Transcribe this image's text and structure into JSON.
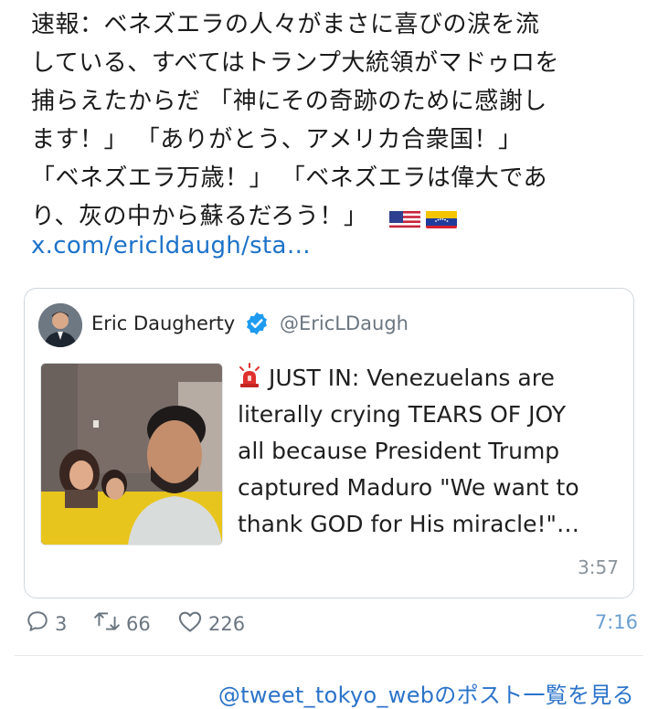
{
  "post": {
    "text_lines": [
      "速報：ベネズエラの人々がまさに喜びの涙を流",
      "している、すべてはトランプ大統領がマドゥロを",
      "捕らえたからだ 「神にその奇跡のために感謝し",
      "ます！」 「ありがとう、アメリカ合衆国！」",
      "「ベネズエラ万歳！」 「ベネズエラは偉大であ",
      "り、灰の中から蘇るだろう！」"
    ],
    "flags": [
      "us-flag-icon",
      "venezuela-flag-icon"
    ],
    "link": "x.com/ericldaugh/sta…",
    "time": "7:16",
    "replies": "3",
    "reposts": "66",
    "likes": "226"
  },
  "quote": {
    "name": "Eric Daugherty",
    "handle": "@EricLDaugh",
    "text_lines": [
      "JUST IN: Venezuelans are",
      "literally crying TEARS OF JOY",
      "all because President Trump",
      "captured Maduro \"We want to",
      "thank GOD for His miracle!\"…"
    ],
    "time": "3:57",
    "icon": "siren-icon"
  },
  "footer": {
    "link": "@tweet_tokyo_webのポスト一覧を見る"
  },
  "colors": {
    "link": "#1d72c8",
    "verified": "#1d9bf0",
    "meta": "#6b7680"
  }
}
